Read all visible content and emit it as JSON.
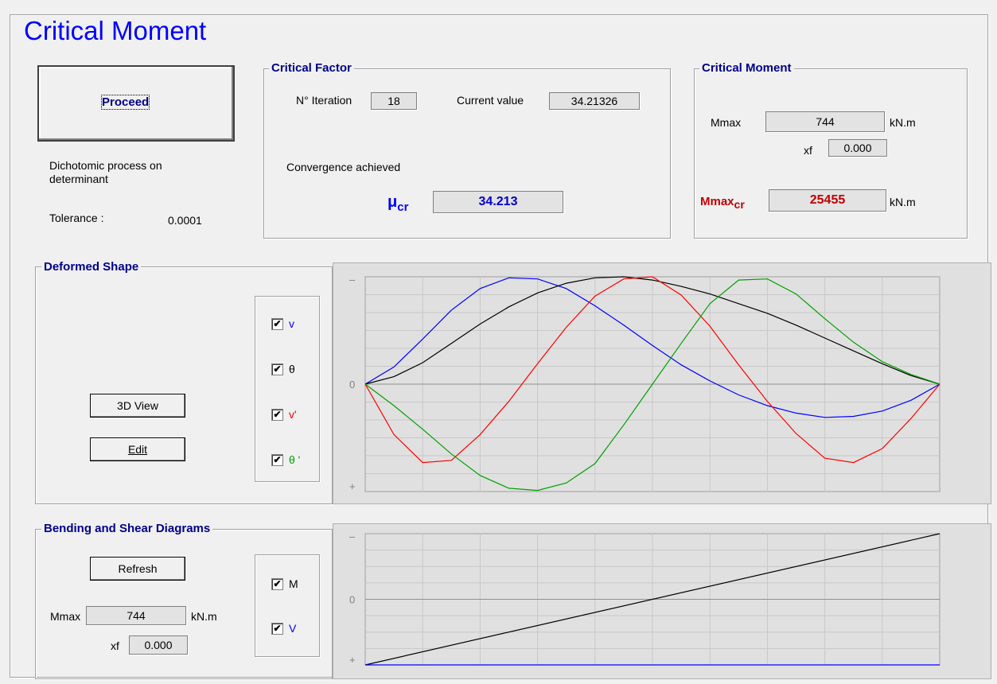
{
  "window": {
    "title": "Critical Moment"
  },
  "left_panel": {
    "proceed_label": "Proceed",
    "process_text_line1": "Dichotomic process on",
    "process_text_line2": "determinant",
    "tolerance_label": "Tolerance :",
    "tolerance_value": "0.0001"
  },
  "critical_factor": {
    "title": "Critical Factor",
    "iteration_label": "N° Iteration",
    "iteration_value": "18",
    "current_label": "Current value",
    "current_value": "34.21326",
    "status": "Convergence achieved",
    "mu_label": "μ",
    "mu_sub": "cr",
    "mu_value": "34.213"
  },
  "critical_moment": {
    "title": "Critical Moment",
    "mmax_label": "Mmax",
    "mmax_value": "744",
    "mmax_unit": "kN.m",
    "xf_label": "xf",
    "xf_value": "0.000",
    "mmaxcr_label": "Mmax",
    "mmaxcr_sub": "cr",
    "mmaxcr_value": "25455",
    "mmaxcr_unit": "kN.m"
  },
  "deformed_shape": {
    "title": "Deformed Shape",
    "view3d_label": "3D View",
    "edit_label": "Edit",
    "checks": [
      {
        "label": "v",
        "checked": true,
        "color": "#0000ff"
      },
      {
        "label": "θ",
        "checked": true,
        "color": "#000000"
      },
      {
        "label": "v'",
        "checked": true,
        "color": "#ff0000"
      },
      {
        "label": "θ '",
        "checked": true,
        "color": "#00a000"
      }
    ],
    "check_mark": "✔"
  },
  "bending_shear": {
    "title": "Bending and Shear Diagrams",
    "refresh_label": "Refresh",
    "mmax_label": "Mmax",
    "mmax_value": "744",
    "mmax_unit": "kN.m",
    "xf_label": "xf",
    "xf_value": "0.000",
    "checks": [
      {
        "label": "M",
        "checked": true,
        "color": "#000000"
      },
      {
        "label": "V",
        "checked": true,
        "color": "#0000ff"
      }
    ]
  },
  "chart_data": [
    {
      "type": "line",
      "ytick_labels": [
        "–",
        "0",
        "+"
      ],
      "x": [
        0,
        0.05,
        0.1,
        0.15,
        0.2,
        0.25,
        0.3,
        0.35,
        0.4,
        0.45,
        0.5,
        0.55,
        0.6,
        0.65,
        0.7,
        0.75,
        0.8,
        0.85,
        0.9,
        0.95,
        1.0
      ],
      "series": [
        {
          "values": [
            0,
            0.16,
            0.42,
            0.69,
            0.89,
            0.99,
            0.98,
            0.89,
            0.73,
            0.55,
            0.36,
            0.18,
            0.03,
            -0.1,
            -0.2,
            -0.27,
            -0.31,
            -0.3,
            -0.25,
            -0.15,
            0
          ],
          "color": "#0000ff"
        },
        {
          "values": [
            0,
            0.07,
            0.2,
            0.38,
            0.56,
            0.72,
            0.85,
            0.94,
            0.99,
            1.0,
            0.97,
            0.91,
            0.84,
            0.75,
            0.66,
            0.55,
            0.43,
            0.31,
            0.19,
            0.08,
            0
          ],
          "color": "#000000"
        },
        {
          "values": [
            0,
            -0.47,
            -0.73,
            -0.71,
            -0.47,
            -0.16,
            0.19,
            0.53,
            0.82,
            0.98,
            1.0,
            0.83,
            0.54,
            0.18,
            -0.16,
            -0.46,
            -0.69,
            -0.73,
            -0.6,
            -0.32,
            0
          ],
          "color": "#ff0000"
        },
        {
          "values": [
            0,
            -0.2,
            -0.42,
            -0.65,
            -0.85,
            -0.97,
            -0.99,
            -0.92,
            -0.74,
            -0.38,
            0.0,
            0.38,
            0.75,
            0.97,
            0.98,
            0.84,
            0.61,
            0.39,
            0.21,
            0.09,
            0
          ],
          "color": "#00a000"
        }
      ]
    },
    {
      "type": "line",
      "ytick_labels": [
        "–",
        "0",
        "+"
      ],
      "x": [
        0,
        1
      ],
      "series": [
        {
          "values": [
            -1,
            1
          ],
          "color": "#000000"
        },
        {
          "values": [
            -1,
            -1
          ],
          "color": "#0000ff"
        }
      ]
    }
  ]
}
